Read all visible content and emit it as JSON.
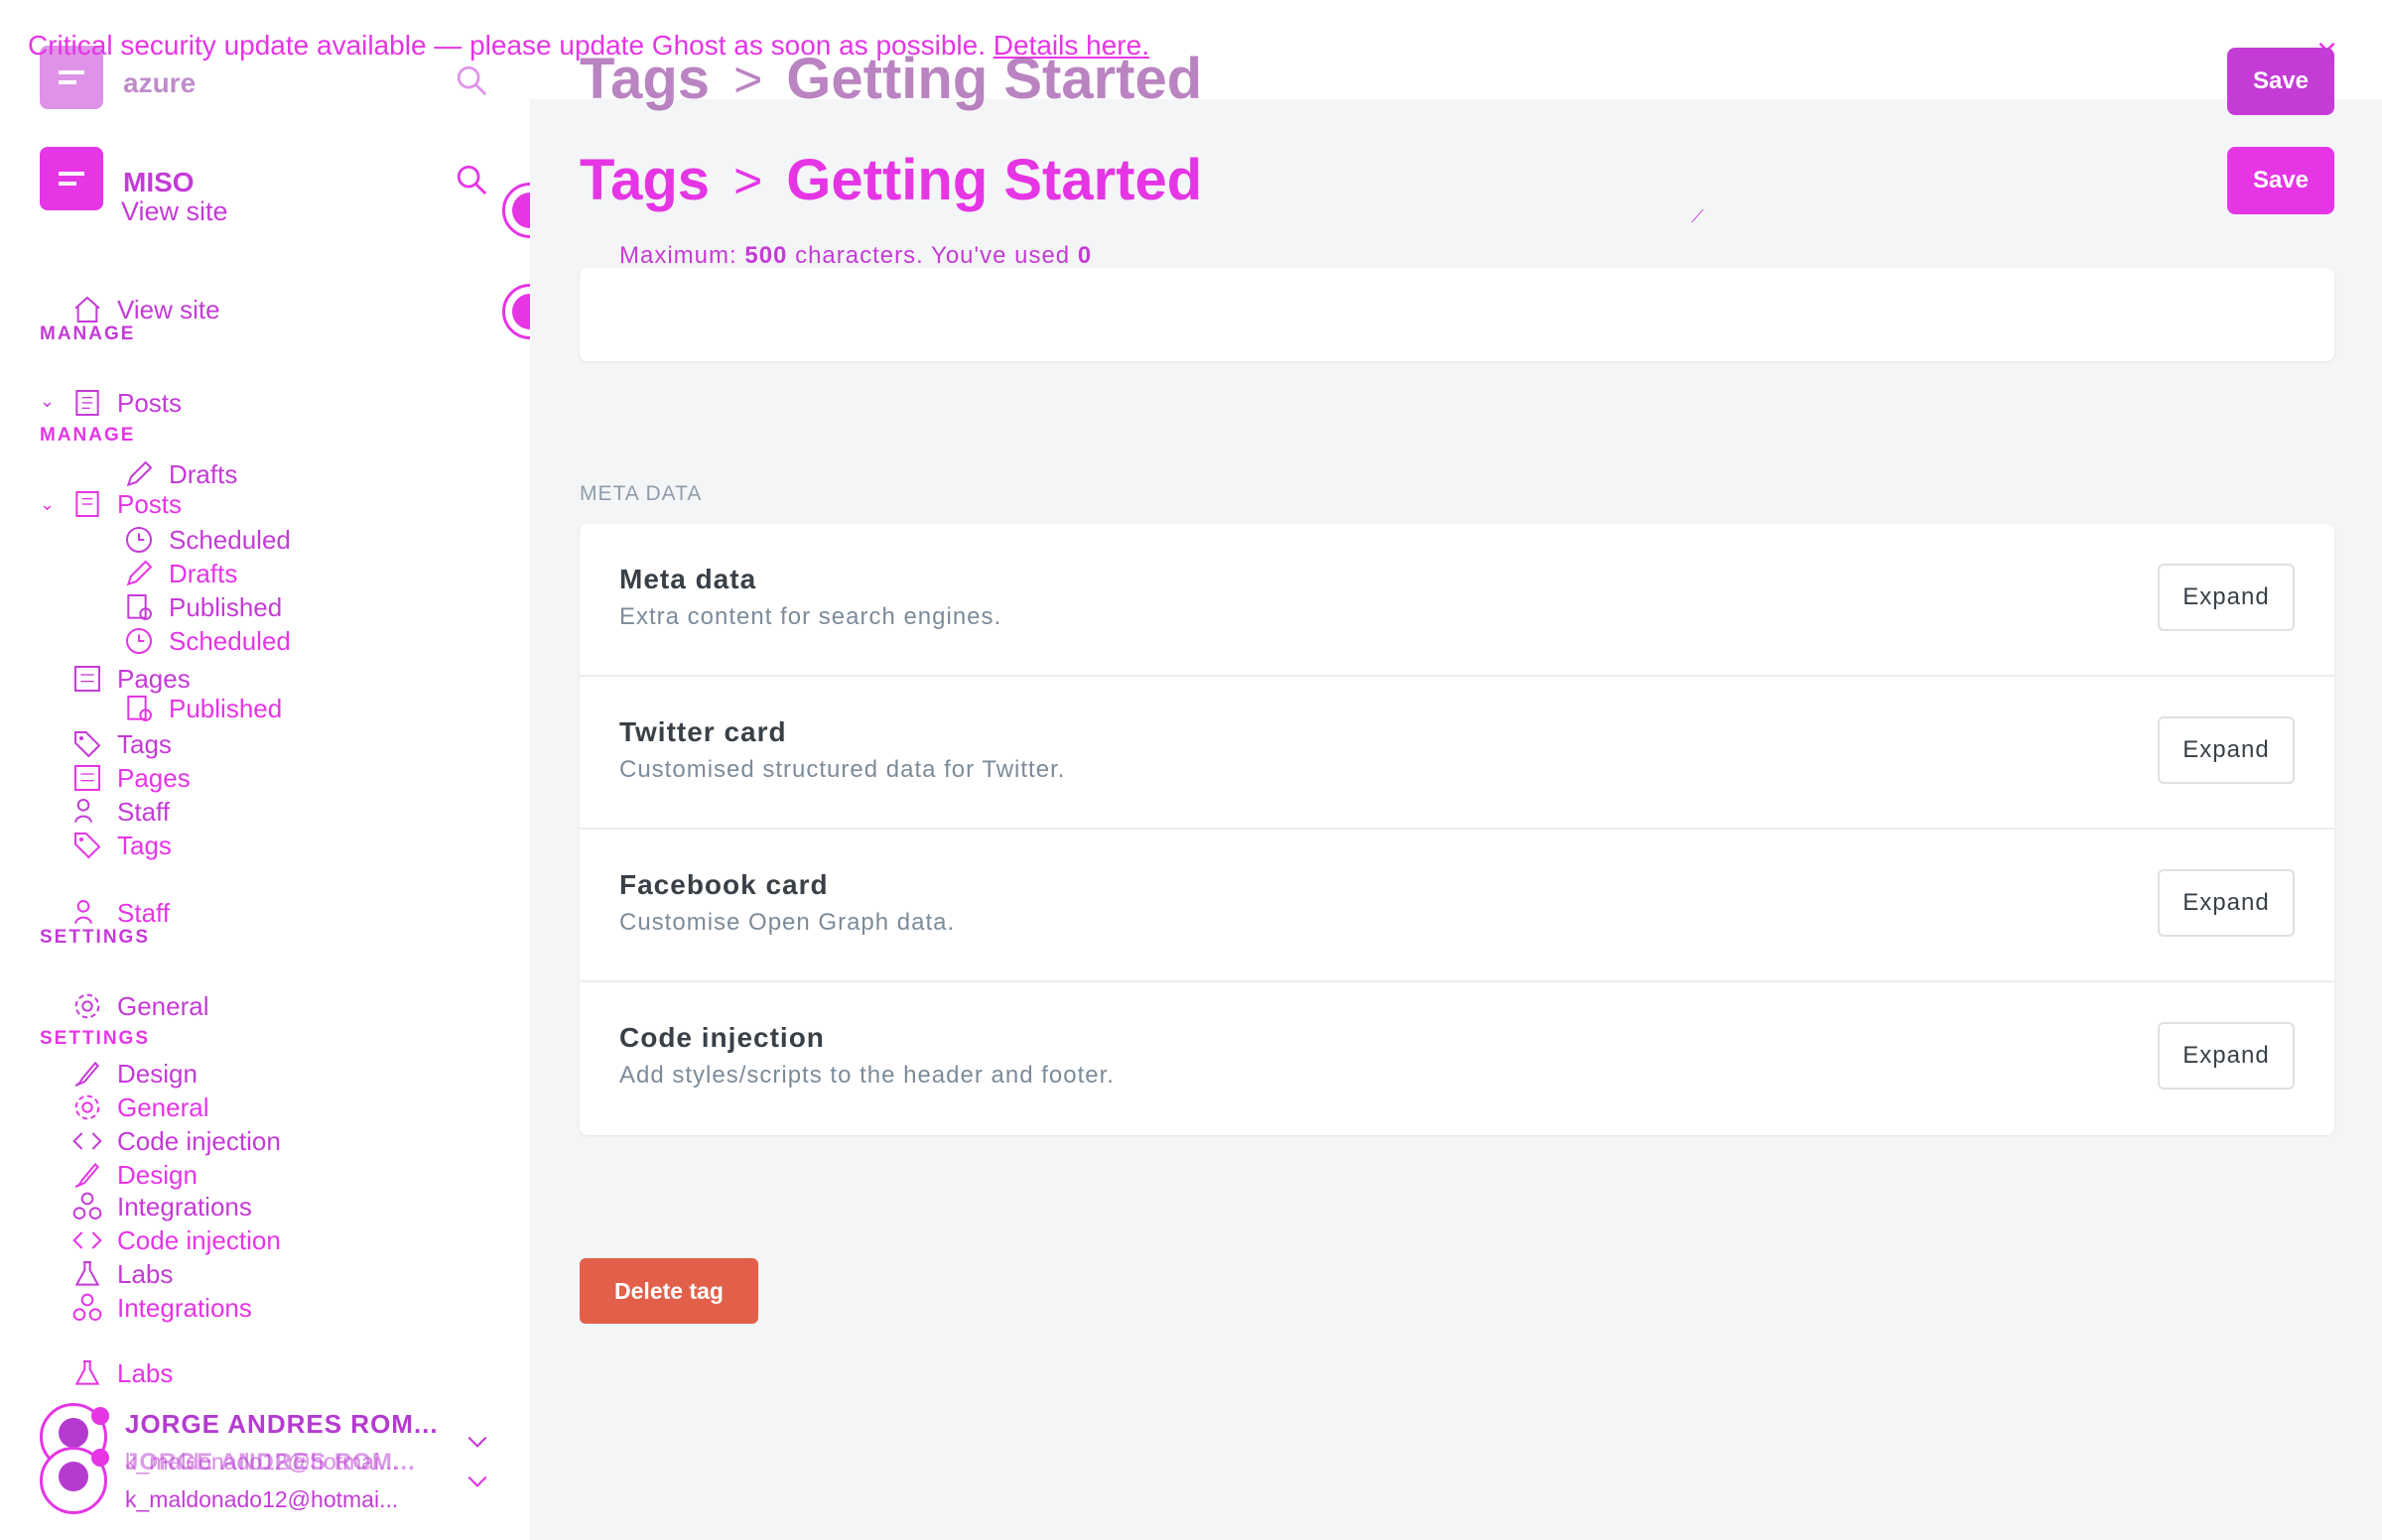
{
  "banner": {
    "text": "Critical security update available — please update Ghost as soon as possible.",
    "link": "Details here.",
    "close": "×"
  },
  "sidebar": {
    "ghost_brand": "azure",
    "brand": "MISO",
    "view_site_top": "View site",
    "view_site": "View site",
    "manage_label_ghost": "MANAGE",
    "manage_label": "MANAGE",
    "settings_label_ghost": "SETTINGS",
    "settings_label": "SETTINGS",
    "manage_ghost": [
      "Posts",
      "Drafts",
      "Scheduled",
      "Published",
      "Pages",
      "Tags",
      "Staff"
    ],
    "manage": [
      "Posts",
      "Drafts",
      "Scheduled",
      "Published",
      "Pages",
      "Tags",
      "Staff"
    ],
    "settings_ghost": [
      "General",
      "Design",
      "Code injection",
      "Integrations",
      "Labs"
    ],
    "settings": [
      "General",
      "Design",
      "Code injection",
      "Integrations",
      "Labs"
    ],
    "user": {
      "name": "JORGE ANDRES ROM...",
      "email_ghost": "k_maldonado12@hotmai...",
      "name_overlap": "JORGE ANDRES ROM...",
      "email": "k_maldonado12@hotmai..."
    }
  },
  "header": {
    "breadcrumb_parent": "Tags",
    "separator": ">",
    "title": "Getting Started",
    "save_label": "Save"
  },
  "description": {
    "prefix": "Maximum:",
    "max": "500",
    "middle": "characters. You've used",
    "used": "0"
  },
  "meta": {
    "heading": "META DATA",
    "rows": [
      {
        "title": "Meta data",
        "desc": "Extra content for search engines.",
        "button": "Expand"
      },
      {
        "title": "Twitter card",
        "desc": "Customised structured data for Twitter.",
        "button": "Expand"
      },
      {
        "title": "Facebook card",
        "desc": "Customise Open Graph data.",
        "button": "Expand"
      },
      {
        "title": "Code injection",
        "desc": "Add styles/scripts to the header and footer.",
        "button": "Expand"
      }
    ]
  },
  "delete_label": "Delete tag",
  "colors": {
    "accent": "#e535e5",
    "danger": "#e2604a",
    "background": "#f4f5f6"
  }
}
